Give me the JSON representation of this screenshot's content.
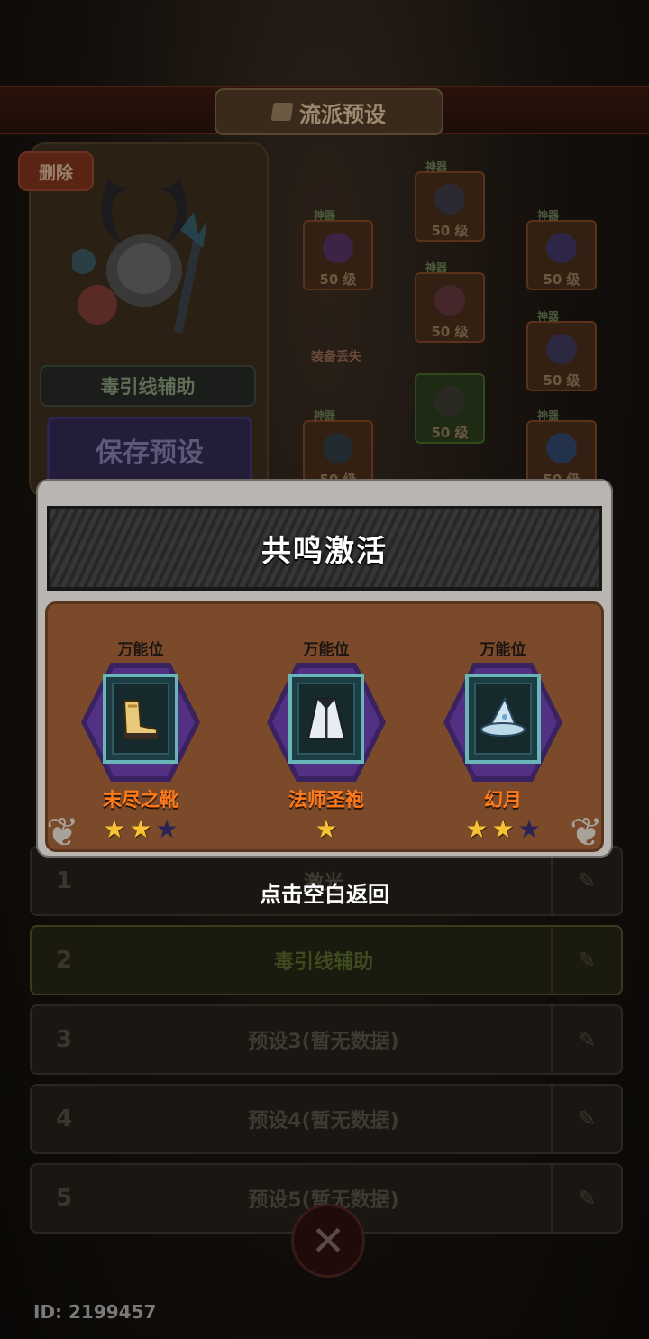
{
  "background": {
    "title": "流派预设",
    "delete_label": "删除",
    "build_name": "毒引线辅助",
    "save_label": "保存预设",
    "slots": [
      {
        "tag": "神器",
        "level": "50 级"
      },
      {
        "tag": "神器",
        "level": "50 级"
      },
      {
        "tag": "神器",
        "level": "50 级"
      },
      {
        "tag": "神器",
        "level": "50 级"
      },
      {
        "tag": "神器",
        "level": "50 级"
      },
      {
        "tag": "",
        "level": "50 级"
      },
      {
        "tag": "神器",
        "level": "50 级"
      },
      {
        "tag": "神器",
        "level": "50 级"
      }
    ],
    "lost_label": "装备丢失",
    "presets": [
      {
        "num": "1",
        "label": "激光"
      },
      {
        "num": "2",
        "label": "毒引线辅助"
      },
      {
        "num": "3",
        "label": "预设3(暂无数据)"
      },
      {
        "num": "4",
        "label": "预设4(暂无数据)"
      },
      {
        "num": "5",
        "label": "预设5(暂无数据)"
      }
    ],
    "id_text": "ID: 2199457"
  },
  "modal": {
    "title": "共鸣激活",
    "items": [
      {
        "tag": "万能位",
        "name": "末尽之靴",
        "stars": 2,
        "max_stars": 3,
        "icon": "boots-icon"
      },
      {
        "tag": "万能位",
        "name": "法师圣袍",
        "stars": 1,
        "max_stars": 1,
        "icon": "robe-icon"
      },
      {
        "tag": "万能位",
        "name": "幻月",
        "stars": 2,
        "max_stars": 3,
        "icon": "wizard-hat-icon"
      }
    ],
    "back_hint": "点击空白返回"
  },
  "colors": {
    "item_name": "#ff7a1a",
    "star_on": "#f7c236",
    "star_off": "#2a2353",
    "modal_body": "#7a4a2a"
  }
}
